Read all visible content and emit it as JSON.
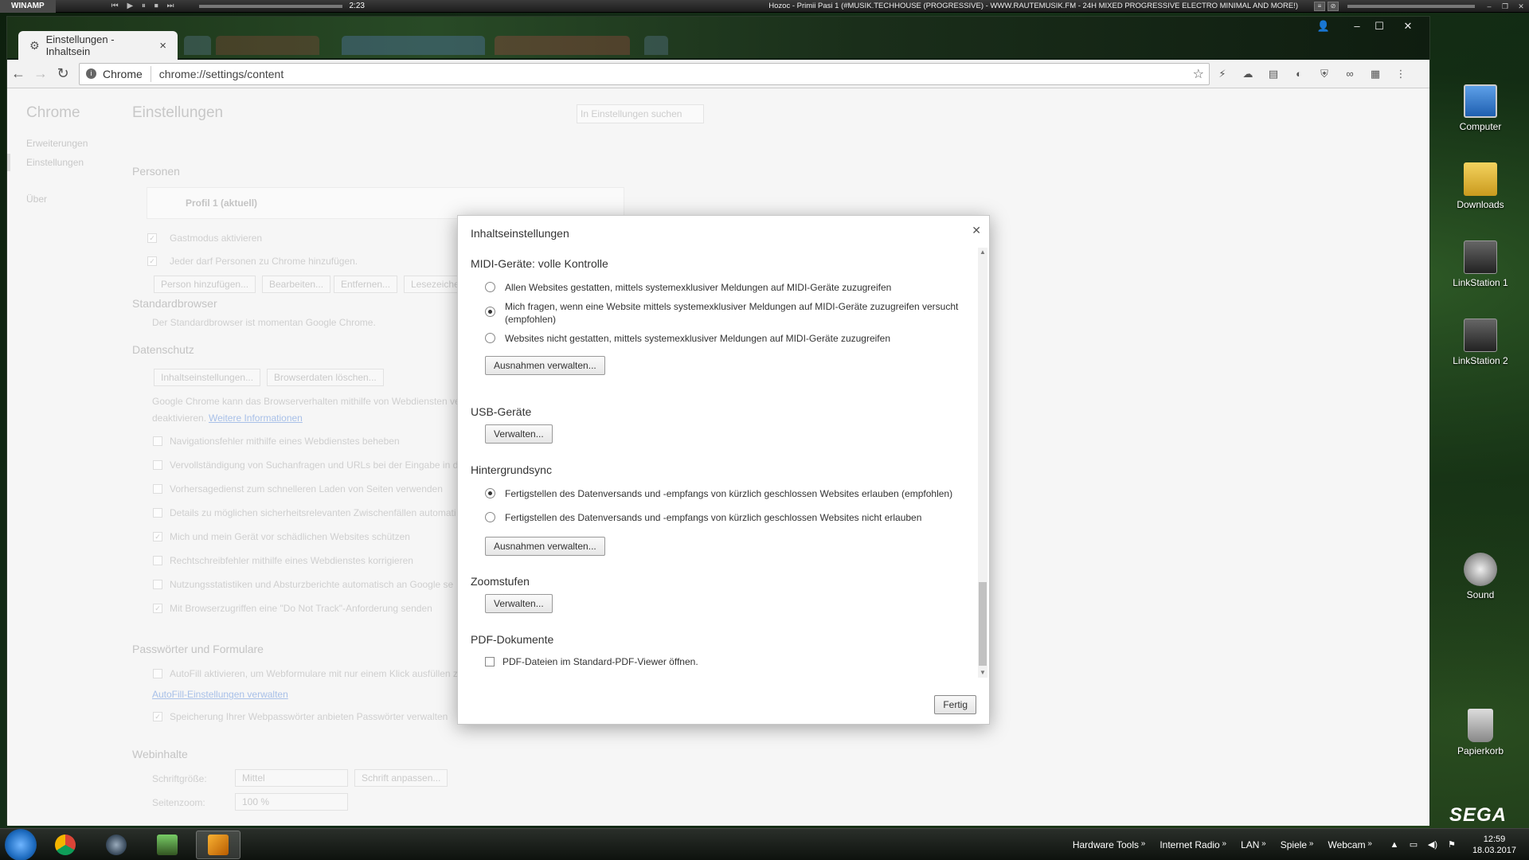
{
  "winamp": {
    "logo": "WINAMP",
    "controls": "⏮ ▶ ⏸ ⏹ ⏭",
    "time": "2:23",
    "title": "Hozoc - Primii Pasi 1 (#MUSIK.TECHHOUSE (PROGRESSIVE) - WWW.RAUTEMUSIK.FM - 24H MIXED PROGRESSIVE ELECTRO MINIMAL AND MORE!)"
  },
  "browser": {
    "active_tab": "Einstellungen - Inhaltsein",
    "omnibox_secure_label": "Chrome",
    "url": "chrome://settings/content",
    "icons": {
      "back": "back-arrow-icon",
      "forward": "forward-arrow-icon",
      "reload": "reload-icon",
      "star": "star-icon",
      "menu": "kebab-menu-icon"
    }
  },
  "settings_bg": {
    "brand": "Chrome",
    "sidebar": [
      "Erweiterungen",
      "Einstellungen",
      "Über"
    ],
    "page_title": "Einstellungen",
    "search_placeholder": "In Einstellungen suchen",
    "sections": {
      "personen": "Personen",
      "profile": "Profil 1 (aktuell)",
      "guest": "Gastmodus aktivieren",
      "anyone": "Jeder darf Personen zu Chrome hinzufügen.",
      "btn_add": "Person hinzufügen...",
      "btn_edit": "Bearbeiten...",
      "btn_remove": "Entfernen...",
      "btn_bookmarks": "Lesezeichen",
      "std_browser": "Standardbrowser",
      "std_browser_text": "Der Standardbrowser ist momentan Google Chrome.",
      "privacy": "Datenschutz",
      "btn_content": "Inhaltseinstellungen...",
      "btn_clear": "Browserdaten löschen...",
      "privacy_text1": "Google Chrome kann das Browserverhalten mithilfe von Webdiensten ve",
      "privacy_text2": "deaktivieren.",
      "privacy_link": "Weitere Informationen",
      "opt1": "Navigationsfehler mithilfe eines Webdienstes beheben",
      "opt2": "Vervollständigung von Suchanfragen und URLs bei der Eingabe in di",
      "opt3": "Vorhersagedienst zum schnelleren Laden von Seiten verwenden",
      "opt4": "Details zu möglichen sicherheitsrelevanten Zwischenfällen automati",
      "opt5": "Mich und mein Gerät vor schädlichen Websites schützen",
      "opt6": "Rechtschreibfehler mithilfe eines Webdienstes korrigieren",
      "opt7": "Nutzungsstatistiken und Absturzberichte automatisch an Google se",
      "opt8": "Mit Browserzugriffen eine \"Do Not Track\"-Anforderung senden",
      "passwords": "Passwörter und Formulare",
      "autofill": "AutoFill aktivieren, um Webformulare mit nur einem Klick ausfüllen z",
      "autofill_link": "AutoFill-Einstellungen verwalten",
      "save_pw": "Speicherung Ihrer Webpasswörter anbieten Passwörter verwalten",
      "webcontent": "Webinhalte",
      "font_size": "Schriftgröße:",
      "font_size_value": "Mittel",
      "btn_font": "Schrift anpassen...",
      "page_zoom": "Seitenzoom:",
      "page_zoom_value": "100 %"
    }
  },
  "dialog": {
    "title": "Inhaltseinstellungen",
    "midi": {
      "title": "MIDI-Geräte: volle Kontrolle",
      "opt_allow": "Allen Websites gestatten, mittels systemexklusiver Meldungen auf MIDI-Geräte zuzugreifen",
      "opt_ask": "Mich fragen, wenn eine Website mittels systemexklusiver Meldungen auf MIDI-Geräte zuzugreifen versucht (empfohlen)",
      "opt_block": "Websites nicht gestatten, mittels systemexklusiver Meldungen auf MIDI-Geräte zuzugreifen",
      "exceptions": "Ausnahmen verwalten..."
    },
    "usb": {
      "title": "USB-Geräte",
      "manage": "Verwalten..."
    },
    "bgsync": {
      "title": "Hintergrundsync",
      "opt_allow": "Fertigstellen des Datenversands und -empfangs von kürzlich geschlossen Websites erlauben (empfohlen)",
      "opt_block": "Fertigstellen des Datenversands und -empfangs von kürzlich geschlossen Websites nicht erlauben",
      "exceptions": "Ausnahmen verwalten..."
    },
    "zoom": {
      "title": "Zoomstufen",
      "manage": "Verwalten..."
    },
    "pdf": {
      "title": "PDF-Dokumente",
      "option": "PDF-Dateien im Standard-PDF-Viewer öffnen."
    },
    "done": "Fertig"
  },
  "desktop": {
    "icons": [
      "Computer",
      "Downloads",
      "LinkStation 1",
      "LinkStation 2",
      "Sound",
      "Papierkorb"
    ],
    "sega": "SEGA"
  },
  "taskbar": {
    "toolbars": [
      "Hardware Tools",
      "Internet Radio",
      "LAN",
      "Spiele",
      "Webcam"
    ],
    "time": "12:59",
    "date": "18.03.2017"
  }
}
